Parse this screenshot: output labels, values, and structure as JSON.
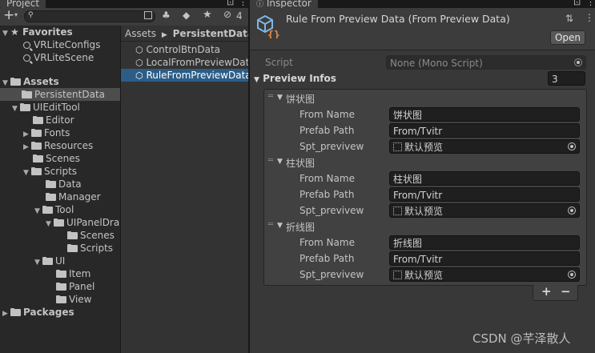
{
  "project": {
    "tab_label": "Project",
    "search_placeholder": "",
    "hidden_count": "4",
    "breadcrumb": {
      "root": "Assets",
      "current": "PersistentData"
    },
    "tree": {
      "favorites": "Favorites",
      "fav_items": [
        "VRLiteConfigs",
        "VRLiteScene"
      ],
      "assets": "Assets",
      "persistent": "PersistentData",
      "uiedit": "UIEditTool",
      "editor": "Editor",
      "fonts": "Fonts",
      "resources": "Resources",
      "scenes": "Scenes",
      "scripts": "Scripts",
      "data": "Data",
      "manager": "Manager",
      "tool": "Tool",
      "uipanel": "UIPanelDrawer",
      "tool_scenes": "Scenes",
      "tool_scripts": "Scripts",
      "ui": "UI",
      "item": "Item",
      "panel": "Panel",
      "view": "View",
      "packages": "Packages"
    },
    "files": [
      "ControlBtnData",
      "LocalFromPreviewData",
      "RuleFromPreviewData"
    ]
  },
  "inspector": {
    "tab_label": "Inspector",
    "title": "Rule From Preview Data (From Preview Data)",
    "open_label": "Open",
    "script_label": "Script",
    "script_value": "None (Mono Script)",
    "preview_infos_label": "Preview Infos",
    "preview_count": "3",
    "field_labels": {
      "from_name": "From Name",
      "prefab_path": "Prefab Path",
      "spt": "Spt_previvew"
    },
    "elements": [
      {
        "header": "饼状图",
        "from_name": "饼状图",
        "prefab_path": "From/Tvitr",
        "spt": "默认预览"
      },
      {
        "header": "柱状图",
        "from_name": "柱状图",
        "prefab_path": "From/Tvitr",
        "spt": "默认预览"
      },
      {
        "header": "折线图",
        "from_name": "折线图",
        "prefab_path": "From/Tvitr",
        "spt": "默认预览"
      }
    ],
    "add_label": "+",
    "remove_label": "−"
  },
  "watermark": "CSDN @芊泽散人",
  "colors": {
    "selection": "#2c5d87",
    "panel": "#282828",
    "inspector": "#383838",
    "field": "#1f1f1f"
  }
}
